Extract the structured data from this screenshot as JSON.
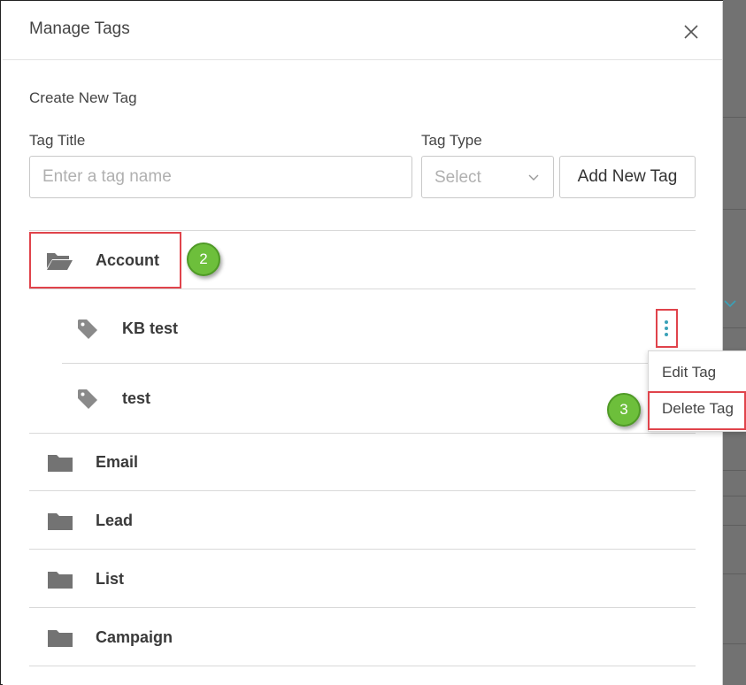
{
  "modal": {
    "title": "Manage Tags"
  },
  "create": {
    "section_label": "Create New Tag",
    "tag_title_label": "Tag Title",
    "tag_title_placeholder": "Enter a tag name",
    "tag_type_label": "Tag Type",
    "tag_type_selected": "Select",
    "add_button": "Add New Tag"
  },
  "folders": [
    {
      "name": "Account",
      "expanded": true
    },
    {
      "name": "Email"
    },
    {
      "name": "Lead"
    },
    {
      "name": "List"
    },
    {
      "name": "Campaign"
    }
  ],
  "tags": [
    {
      "name": "KB test"
    },
    {
      "name": "test"
    }
  ],
  "context_menu": {
    "edit": "Edit Tag",
    "delete": "Delete Tag"
  },
  "callouts": {
    "step_account": "2",
    "step_delete": "3"
  },
  "colors": {
    "highlight": "#e0434b",
    "badge": "#6dbf3b",
    "kebab": "#3aa1b8",
    "folder_icon": "#737373",
    "tag_icon": "#8a8a8a"
  }
}
